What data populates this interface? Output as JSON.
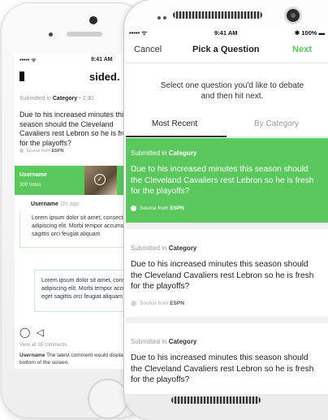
{
  "back_screen": {
    "status": {
      "signal": "••••• ᯤ",
      "time": "9:41 AM"
    },
    "logo": "sided.",
    "meta": {
      "prefix": "Submitted in",
      "category": "Category",
      "time": "• 2:30"
    },
    "question": "Due to his increased minutes this season should the Cleveland Cavaliers rest Lebron so he is fresh for the playoffs?",
    "source": {
      "prefix": "Source from",
      "name": "ESPN"
    },
    "vote_bar": {
      "username": "Username",
      "votes": "300 Votes"
    },
    "comment": {
      "username": "Username",
      "time": "1hr ago",
      "text": "Lorem ipsum dolor sit amet, consectetur adipiscing elit. Morbi tempor accumsan eget sagittis orci feugiat aliquam"
    },
    "reply": {
      "text": "Lorem ipsum dolor sit amet, consectetur adipiscing elit. Morbi tempor accumsan eget sagittis orci feugiat aliquam"
    },
    "view_all": "View all 15 comments",
    "last_comment": {
      "username": "Username",
      "text": "The latest comment would display at the bottom of the screen."
    }
  },
  "front_screen": {
    "status": {
      "signal": "••••• ᯤ",
      "time": "9:41 AM",
      "battery": "✱ 100% ▬"
    },
    "nav": {
      "cancel": "Cancel",
      "title": "Pick a Question",
      "next": "Next"
    },
    "instruction": "Select one question you'd like to debate and then hit next.",
    "tabs": [
      {
        "label": "Most Recent",
        "active": true
      },
      {
        "label": "By Category",
        "active": false
      }
    ],
    "cards": [
      {
        "prefix": "Submitted in",
        "category": "Category",
        "question": "Due to his increased minutes this season should the Cleveland Cavaliers rest Lebron so he is fresh for the playoffs?",
        "source_prefix": "Source from",
        "source_name": "ESPN",
        "selected": true
      },
      {
        "prefix": "Submitted in",
        "category": "Category",
        "question": "Due to his increased minutes this season should the Cleveland Cavaliers rest Lebron so he is fresh for the playoffs?",
        "source_prefix": "Source from",
        "source_name": "ESPN",
        "selected": false
      },
      {
        "prefix": "Submitted in",
        "category": "Category",
        "question": "Due to his increased minutes this season should the Cleveland Cavaliers rest Lebron so he is fresh for the playoffs?",
        "selected": false
      }
    ]
  },
  "colors": {
    "accent": "#5ac85d"
  },
  "icons": {
    "comment": "comment-bubble-icon",
    "share": "send-icon",
    "check": "check-circle-icon",
    "camera": "camera-icon"
  }
}
